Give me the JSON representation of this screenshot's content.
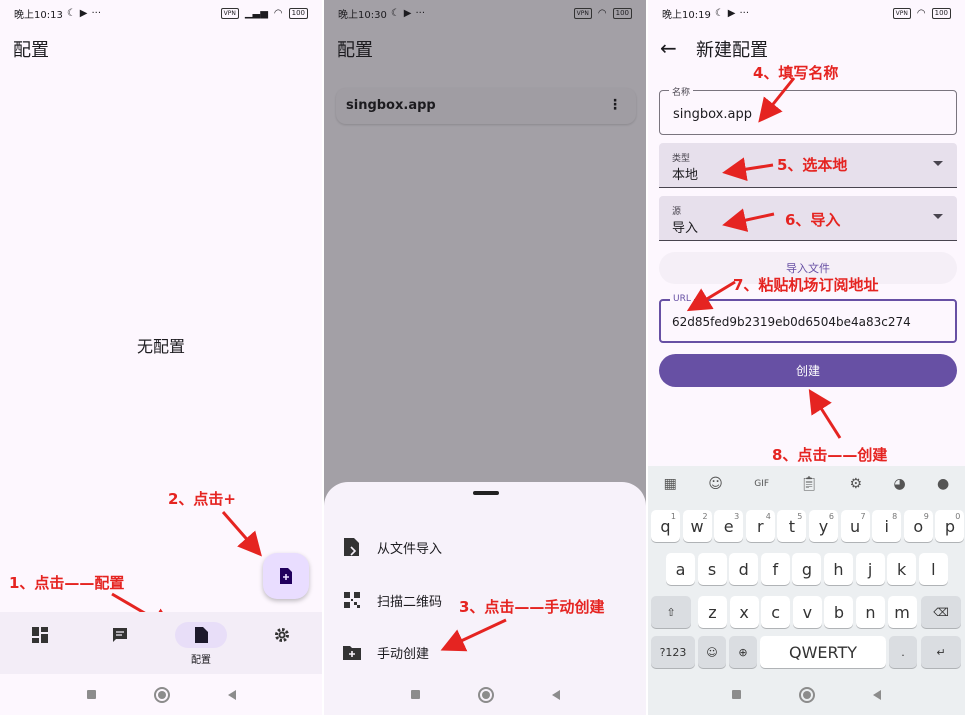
{
  "panel1": {
    "status": {
      "time": "晚上10:13",
      "battery": "100"
    },
    "title": "配置",
    "empty_text": "无配置",
    "nav_active_label": "配置",
    "annotation_fab": "2、点击+",
    "annotation_nav": "1、点击——配置"
  },
  "panel2": {
    "status": {
      "time": "晚上10:30",
      "battery": "100"
    },
    "title": "配置",
    "profile_name": "singbox.app",
    "sheet_items": [
      {
        "label": "从文件导入",
        "icon": "file-import-icon"
      },
      {
        "label": "扫描二维码",
        "icon": "qr-code-icon"
      },
      {
        "label": "手动创建",
        "icon": "folder-add-icon"
      }
    ],
    "annotation": "3、点击——手动创建"
  },
  "panel3": {
    "status": {
      "time": "晚上10:19",
      "battery": "100"
    },
    "title": "新建配置",
    "name_label": "名称",
    "name_value": "singbox.app",
    "type_label": "类型",
    "type_value": "本地",
    "source_label": "源",
    "source_value": "导入",
    "import_button": "导入文件",
    "url_label": "URL",
    "url_value": "62d85fed9b2319eb0d6504be4a83c274",
    "create_button": "创建",
    "annotations": {
      "a4": "4、填写名称",
      "a5": "5、选本地",
      "a6": "6、导入",
      "a7": "7、粘贴机场订阅地址",
      "a8": "8、点击——创建"
    },
    "keyboard": {
      "row1": [
        "q",
        "w",
        "e",
        "r",
        "t",
        "y",
        "u",
        "i",
        "o",
        "p"
      ],
      "row1_sup": [
        "1",
        "2",
        "3",
        "4",
        "5",
        "6",
        "7",
        "8",
        "9",
        "0"
      ],
      "row2": [
        "a",
        "s",
        "d",
        "f",
        "g",
        "h",
        "j",
        "k",
        "l"
      ],
      "row3": [
        "z",
        "x",
        "c",
        "v",
        "b",
        "n",
        "m"
      ],
      "num_key": "?123",
      "emoji_key": "☺",
      "globe_key": "⊕",
      "space": "QWERTY",
      "period": ".",
      "gif": "GIF"
    }
  },
  "colors": {
    "primary": "#6750a4",
    "annotation_red": "#e52421",
    "scrim": "#a3a0a6"
  }
}
